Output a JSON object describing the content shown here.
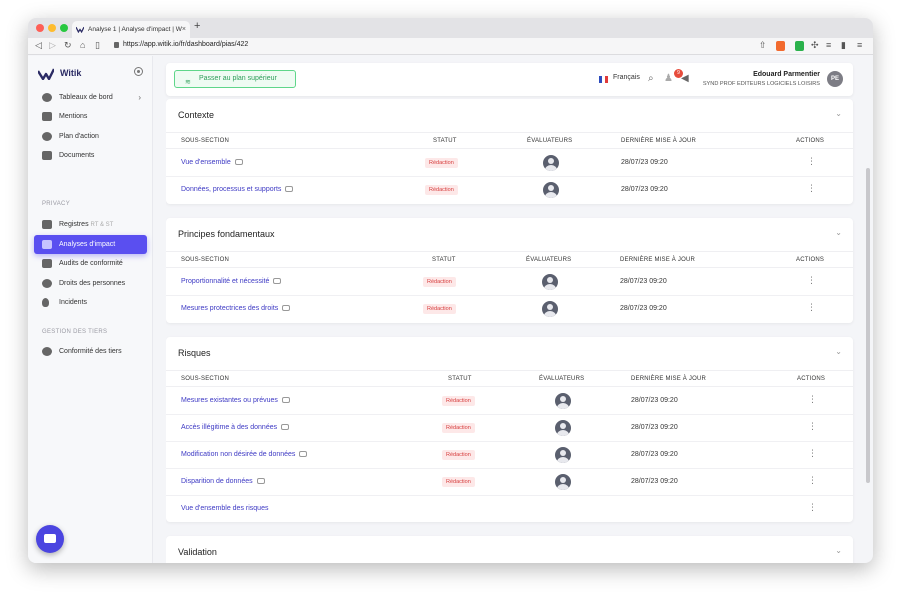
{
  "browser": {
    "tab_title": "Analyse 1 | Analyse d'impact | W",
    "tab_close": "×",
    "new_tab": "+",
    "url": "https://app.witik.io/fr/dashboard/pias/422"
  },
  "sidebar": {
    "brand": "Witik",
    "main_items": [
      {
        "label": "Tableaux de bord",
        "icon": "dashboard-icon"
      },
      {
        "label": "Mentions",
        "icon": "mentions-icon"
      },
      {
        "label": "Plan d'action",
        "icon": "target-icon"
      },
      {
        "label": "Documents",
        "icon": "folder-icon"
      }
    ],
    "privacy_label": "PRIVACY",
    "privacy_items": [
      {
        "label": "Registres",
        "suffix": "RT & ST",
        "icon": "books-icon"
      },
      {
        "label": "Analyses d'impact",
        "icon": "shield-icon",
        "active": true
      },
      {
        "label": "Audits de conformité",
        "icon": "audit-icon"
      },
      {
        "label": "Droits des personnes",
        "icon": "people-icon"
      },
      {
        "label": "Incidents",
        "icon": "fire-icon"
      }
    ],
    "tiers_label": "GESTION DES TIERS",
    "tiers_items": [
      {
        "label": "Conformité des tiers",
        "icon": "network-icon"
      }
    ]
  },
  "header": {
    "upgrade_label": "Passer au plan supérieur",
    "language": "Français",
    "notifications_count": "9",
    "user_name": "Edouard Parmentier",
    "user_org": "SYND PROF EDITEURS LOGICIELS LOISIRS",
    "user_initials": "PE"
  },
  "columns": {
    "section": "SOUS-SECTION",
    "status": "STATUT",
    "evaluators": "ÉVALUATEURS",
    "updated": "DERNIÈRE MISE À JOUR",
    "actions": "ACTIONS"
  },
  "cards": [
    {
      "title": "Contexte",
      "rows": [
        {
          "name": "Vue d'ensemble",
          "status": "Rédaction",
          "date": "28/07/23 09:20"
        },
        {
          "name": "Données, processus et supports",
          "status": "Rédaction",
          "date": "28/07/23 09:20"
        }
      ]
    },
    {
      "title": "Principes fondamentaux",
      "rows": [
        {
          "name": "Proportionnalité et nécessité",
          "status": "Rédaction",
          "date": "28/07/23 09:20"
        },
        {
          "name": "Mesures protectrices des droits",
          "status": "Rédaction",
          "date": "28/07/23 09:20"
        }
      ]
    },
    {
      "title": "Risques",
      "rows": [
        {
          "name": "Mesures existantes ou prévues",
          "status": "Rédaction",
          "date": "28/07/23 09:20"
        },
        {
          "name": "Accès illégitime à des données",
          "status": "Rédaction",
          "date": "28/07/23 09:20"
        },
        {
          "name": "Modification non désirée de données",
          "status": "Rédaction",
          "date": "28/07/23 09:20"
        },
        {
          "name": "Disparition de données",
          "status": "Rédaction",
          "date": "28/07/23 09:20"
        },
        {
          "name": "Vue d'ensemble des risques",
          "status": "",
          "date": ""
        }
      ]
    },
    {
      "title": "Validation",
      "rows": []
    }
  ]
}
